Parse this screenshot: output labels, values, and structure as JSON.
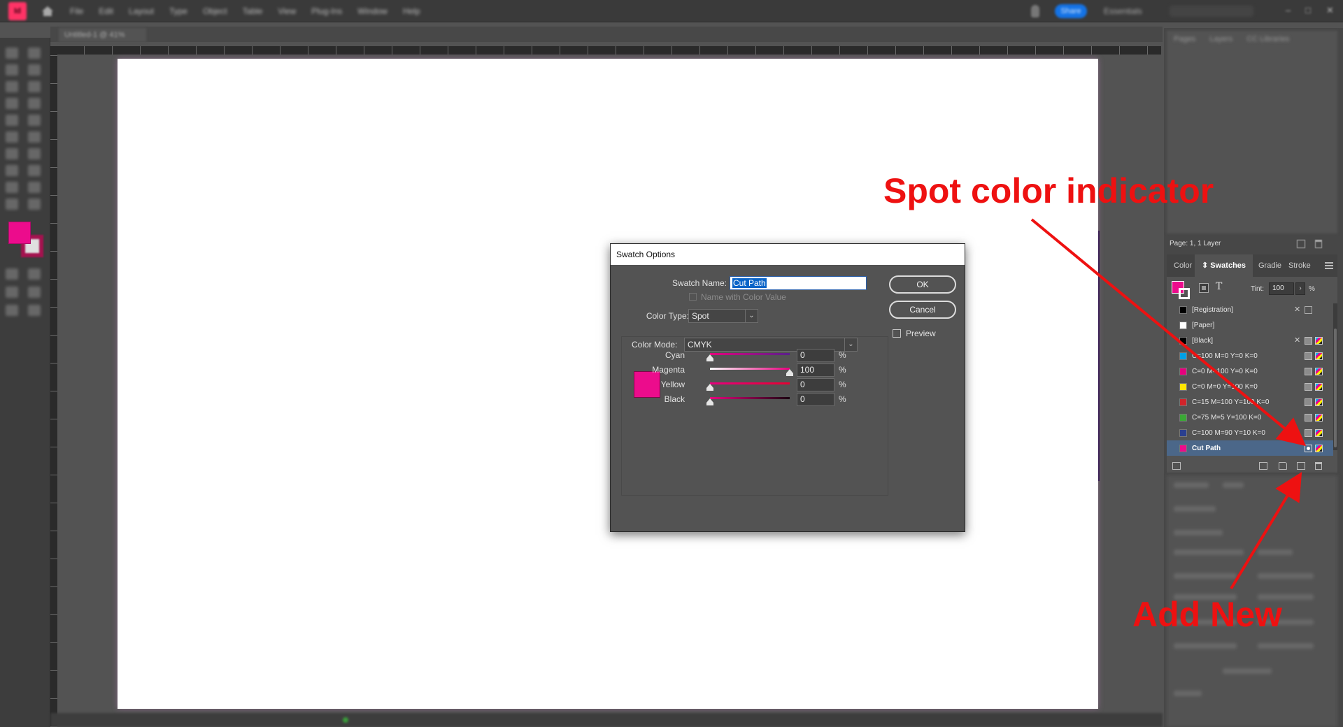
{
  "app": {
    "logo": "Id",
    "menu": [
      "File",
      "Edit",
      "Layout",
      "Type",
      "Object",
      "Table",
      "View",
      "Plug-Ins",
      "Window",
      "Help"
    ],
    "share_label": "Share",
    "workspace": "Essentials",
    "document_tab": "Untitled-1 @ 41%"
  },
  "pages_panel": {
    "tabs": [
      "Pages",
      "Layers",
      "CC Libraries"
    ],
    "info": "Page: 1, 1 Layer"
  },
  "swatches_panel": {
    "tabs": [
      "Color",
      "Swatches",
      "Gradie",
      "Stroke"
    ],
    "tint_label": "Tint:",
    "tint_value": "100",
    "tint_unit": "%",
    "text_icon_glyph": "T",
    "swatches": [
      {
        "name": "[Registration]",
        "color": "#000000",
        "none": true,
        "type": "reg"
      },
      {
        "name": "[Paper]",
        "color": "#ffffff",
        "none": false,
        "type": ""
      },
      {
        "name": "[Black]",
        "color": "#000000",
        "none": true,
        "type": "process"
      },
      {
        "name": "C=100 M=0 Y=0 K=0",
        "color": "#00a0e6",
        "none": false,
        "type": "process"
      },
      {
        "name": "C=0 M=100 Y=0 K=0",
        "color": "#e6007e",
        "none": false,
        "type": "process"
      },
      {
        "name": "C=0 M=0 Y=100 K=0",
        "color": "#ffe600",
        "none": false,
        "type": "process"
      },
      {
        "name": "C=15 M=100 Y=100 K=0",
        "color": "#d2232a",
        "none": false,
        "type": "process"
      },
      {
        "name": "C=75 M=5 Y=100 K=0",
        "color": "#3aa935",
        "none": false,
        "type": "process"
      },
      {
        "name": "C=100 M=90 Y=10 K=0",
        "color": "#2a3f8f",
        "none": false,
        "type": "process"
      },
      {
        "name": "Cut Path",
        "color": "#ec0c8c",
        "none": false,
        "type": "spot",
        "selected": true
      }
    ]
  },
  "properties_panel": {
    "tabs": [
      "Properties",
      "Links"
    ]
  },
  "dialog": {
    "title": "Swatch Options",
    "swatch_name_label": "Swatch Name:",
    "swatch_name_value": "Cut Path",
    "name_with_color_label": "Name with Color Value",
    "color_type_label": "Color Type:",
    "color_type_value": "Spot",
    "color_mode_label": "Color Mode:",
    "color_mode_value": "CMYK",
    "ok_label": "OK",
    "cancel_label": "Cancel",
    "preview_label": "Preview",
    "preview_color": "#ec0c8c",
    "channels": [
      {
        "label": "Cyan",
        "value": "0",
        "unit": "%"
      },
      {
        "label": "Magenta",
        "value": "100",
        "unit": "%"
      },
      {
        "label": "Yellow",
        "value": "0",
        "unit": "%"
      },
      {
        "label": "Black",
        "value": "0",
        "unit": "%"
      }
    ]
  },
  "annotations": {
    "spot_indicator": "Spot color indicator",
    "add_new": "Add New",
    "color": "#ee1111"
  }
}
